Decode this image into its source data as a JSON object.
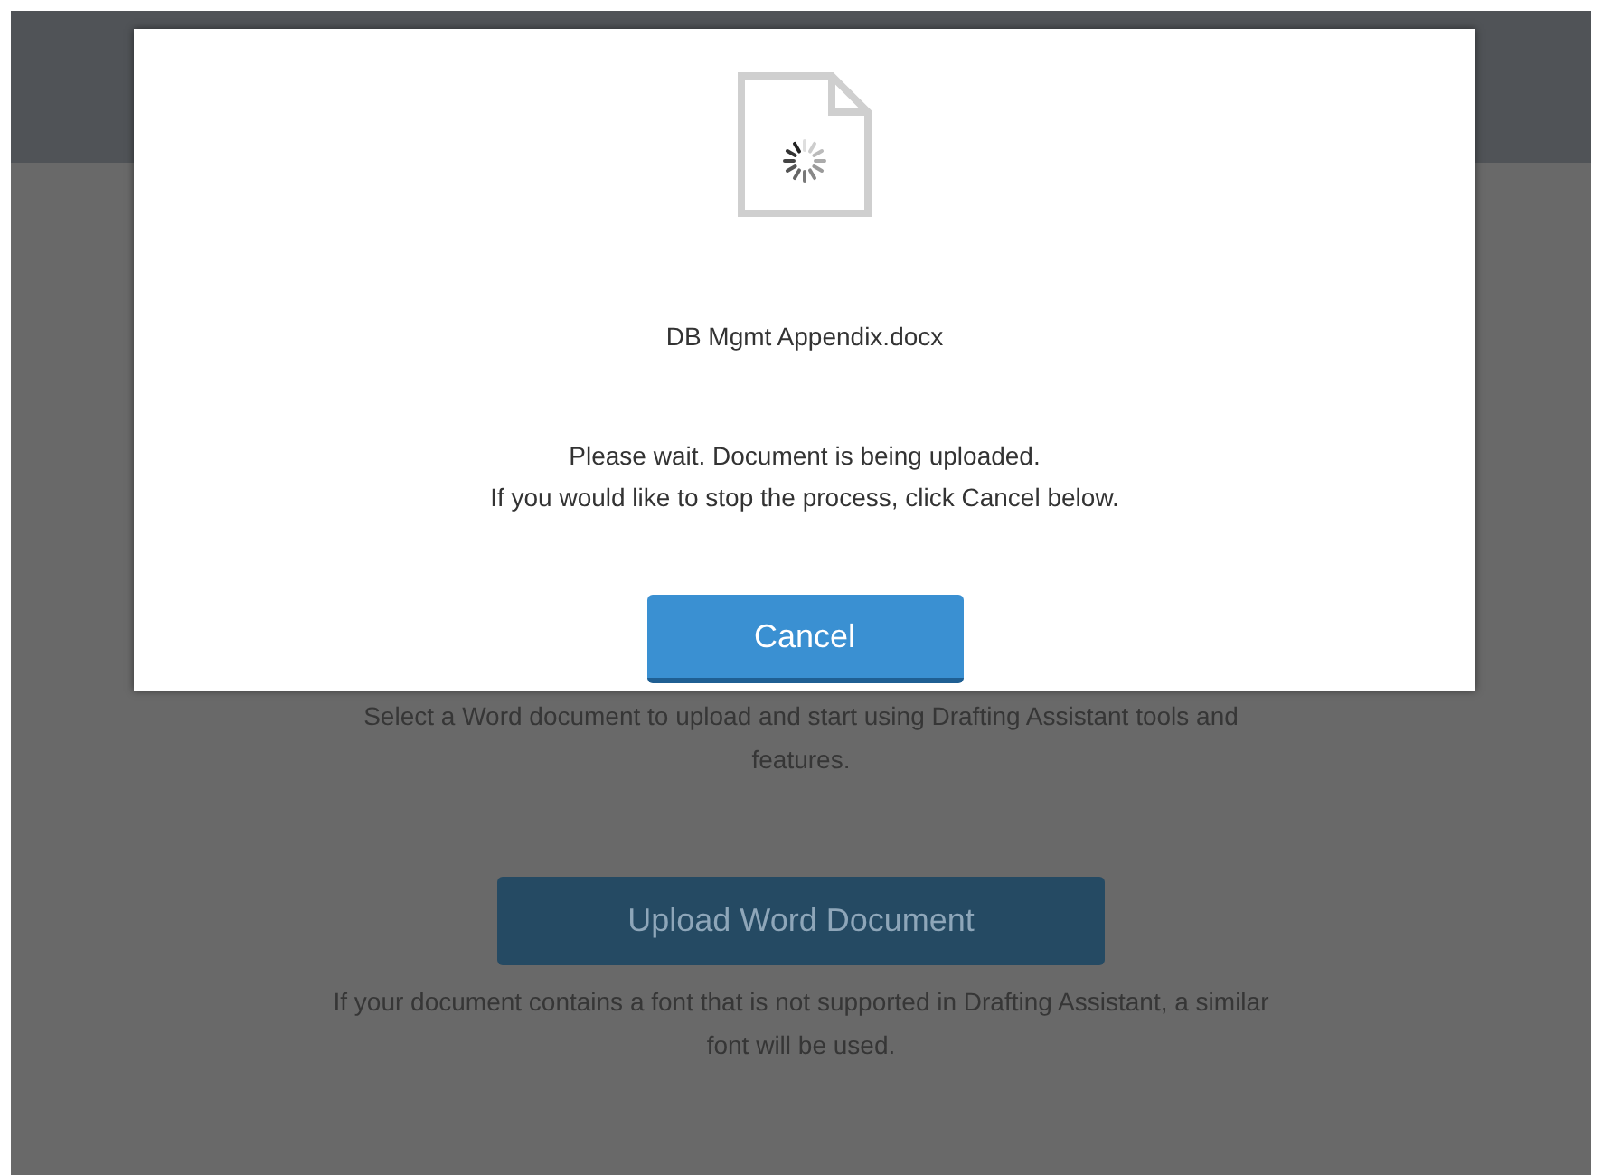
{
  "background_page": {
    "intro": "Select a Word document to upload and start using Drafting Assistant tools and features.",
    "upload_button": "Upload Word Document",
    "font_note": "If your document contains a font that is not supported in Drafting Assistant, a similar font will be used."
  },
  "dialog": {
    "file_name": "DB Mgmt Appendix.docx",
    "message_lines": [
      "Please wait. Document is being uploaded.",
      "If you would like to stop the process, click Cancel below."
    ],
    "cancel_button": "Cancel"
  }
}
